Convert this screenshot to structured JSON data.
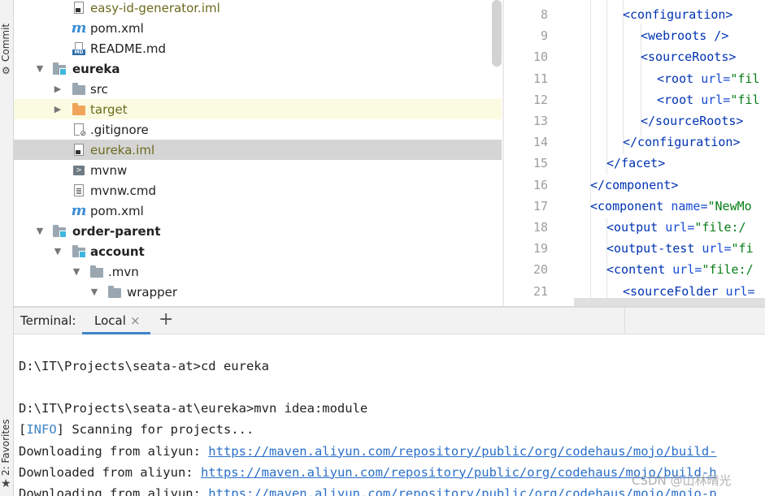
{
  "left_strip": {
    "commit_label": "Commit",
    "favorites_label": "2: Favorites"
  },
  "tree": [
    {
      "name": "easy-id-generator.iml",
      "icon": "iml-file-icon",
      "style": "olive",
      "bold": false,
      "arrow": ""
    },
    {
      "name": "pom.xml",
      "icon": "maven-icon",
      "style": "",
      "bold": false,
      "arrow": ""
    },
    {
      "name": "README.md",
      "icon": "markdown-icon",
      "style": "",
      "bold": false,
      "arrow": ""
    },
    {
      "name": "eureka",
      "icon": "module-folder-icon",
      "style": "",
      "bold": true,
      "arrow": "down"
    },
    {
      "name": "src",
      "icon": "folder-icon",
      "style": "",
      "bold": false,
      "arrow": "right"
    },
    {
      "name": "target",
      "icon": "excluded-folder-icon",
      "style": "olive",
      "bold": false,
      "arrow": "right"
    },
    {
      "name": ".gitignore",
      "icon": "gitignore-icon",
      "style": "",
      "bold": false,
      "arrow": ""
    },
    {
      "name": "eureka.iml",
      "icon": "iml-file-icon",
      "style": "olive",
      "bold": false,
      "arrow": ""
    },
    {
      "name": "mvnw",
      "icon": "shell-script-icon",
      "style": "",
      "bold": false,
      "arrow": ""
    },
    {
      "name": "mvnw.cmd",
      "icon": "text-file-icon",
      "style": "",
      "bold": false,
      "arrow": ""
    },
    {
      "name": "pom.xml",
      "icon": "maven-icon",
      "style": "",
      "bold": false,
      "arrow": ""
    },
    {
      "name": "order-parent",
      "icon": "module-folder-icon",
      "style": "",
      "bold": true,
      "arrow": "down"
    },
    {
      "name": "account",
      "icon": "module-folder-icon",
      "style": "",
      "bold": true,
      "arrow": "down"
    },
    {
      "name": ".mvn",
      "icon": "folder-icon",
      "style": "",
      "bold": false,
      "arrow": "down"
    },
    {
      "name": "wrapper",
      "icon": "folder-icon",
      "style": "",
      "bold": false,
      "arrow": "down"
    }
  ],
  "editor": {
    "line_numbers": [
      "8",
      "9",
      "10",
      "11",
      "12",
      "13",
      "14",
      "15",
      "16",
      "17",
      "18",
      "19",
      "20",
      "21"
    ],
    "lines": [
      [
        {
          "t": "<configuration>",
          "c": "tag"
        }
      ],
      [
        {
          "t": "<webroots />",
          "c": "tag"
        }
      ],
      [
        {
          "t": "<sourceRoots>",
          "c": "tag"
        }
      ],
      [
        {
          "t": "<root ",
          "c": "tag"
        },
        {
          "t": "url=",
          "c": "attr"
        },
        {
          "t": "\"fil",
          "c": "str"
        }
      ],
      [
        {
          "t": "<root ",
          "c": "tag"
        },
        {
          "t": "url=",
          "c": "attr"
        },
        {
          "t": "\"fil",
          "c": "str"
        }
      ],
      [
        {
          "t": "</sourceRoots>",
          "c": "tag"
        }
      ],
      [
        {
          "t": "</configuration>",
          "c": "tag"
        }
      ],
      [
        {
          "t": "</facet>",
          "c": "tag"
        }
      ],
      [
        {
          "t": "</component>",
          "c": "tag"
        }
      ],
      [
        {
          "t": "<component ",
          "c": "tag"
        },
        {
          "t": "name=",
          "c": "attr"
        },
        {
          "t": "\"NewMo",
          "c": "str"
        }
      ],
      [
        {
          "t": "<output ",
          "c": "tag"
        },
        {
          "t": "url=",
          "c": "attr"
        },
        {
          "t": "\"file:/",
          "c": "str"
        }
      ],
      [
        {
          "t": "<output-test ",
          "c": "tag"
        },
        {
          "t": "url=",
          "c": "attr"
        },
        {
          "t": "\"fi",
          "c": "str"
        }
      ],
      [
        {
          "t": "<content ",
          "c": "tag"
        },
        {
          "t": "url=",
          "c": "attr"
        },
        {
          "t": "\"file:/",
          "c": "str"
        }
      ],
      [
        {
          "t": "<sourceFolder ",
          "c": "tag"
        },
        {
          "t": "url=",
          "c": "attr"
        }
      ]
    ]
  },
  "terminal": {
    "title": "Terminal:",
    "tab_label": "Local",
    "close_glyph": "×",
    "new_tab_glyph": "+",
    "lines": [
      [
        {
          "t": ""
        }
      ],
      [
        {
          "t": "D:\\IT\\Projects\\seata-at>cd eureka"
        }
      ],
      [
        {
          "t": ""
        }
      ],
      [
        {
          "t": "D:\\IT\\Projects\\seata-at\\eureka>mvn idea:module"
        }
      ],
      [
        {
          "t": "["
        },
        {
          "t": "INFO",
          "c": "info"
        },
        {
          "t": "] Scanning for projects..."
        }
      ],
      [
        {
          "t": "Downloading from aliyun: "
        },
        {
          "t": "https://maven.aliyun.com/repository/public/org/codehaus/mojo/build-",
          "c": "link"
        }
      ],
      [
        {
          "t": "Downloaded from aliyun: "
        },
        {
          "t": "https://maven.aliyun.com/repository/public/org/codehaus/mojo/build-h",
          "c": "link"
        }
      ],
      [
        {
          "t": "Downloading from aliyun: "
        },
        {
          "t": "https://maven.aliyun.com/repository/public/org/codehaus/mojo/mojo-p",
          "c": "link"
        }
      ]
    ]
  },
  "watermark": "CSDN @山林晴光",
  "colors": {
    "tag": "#0033b3",
    "attr": "#174ad4",
    "string": "#067d17",
    "link": "#2a6fc9",
    "info": "#3e84c4",
    "tab_underline": "#4083c9",
    "excluded_text": "#6b6b1e",
    "module_badge": "#40b6e0"
  }
}
